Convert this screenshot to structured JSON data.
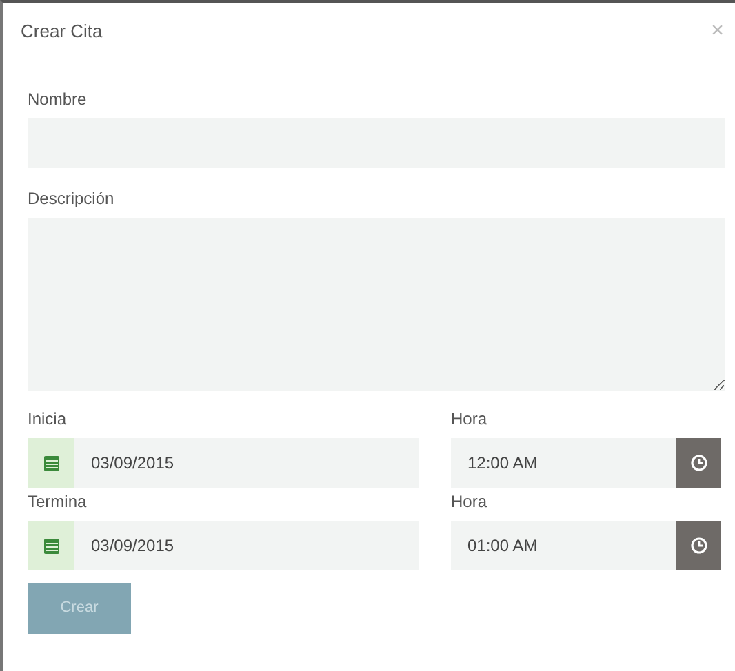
{
  "dialog": {
    "title": "Crear Cita",
    "close": "×"
  },
  "fields": [
    {
      "label": "Nombre",
      "kind": "input"
    },
    {
      "label": "Descripción",
      "kind": "textarea"
    }
  ],
  "datetimes": [
    {
      "date_label": "Inicia",
      "date": "03/09/2015",
      "time_label": "Hora",
      "time": "12:00 AM"
    },
    {
      "date_label": "Termina",
      "date": "03/09/2015",
      "time_label": "Hora",
      "time": "01:00 AM"
    }
  ],
  "submit": {
    "label": "Crear",
    "disabled": true
  }
}
